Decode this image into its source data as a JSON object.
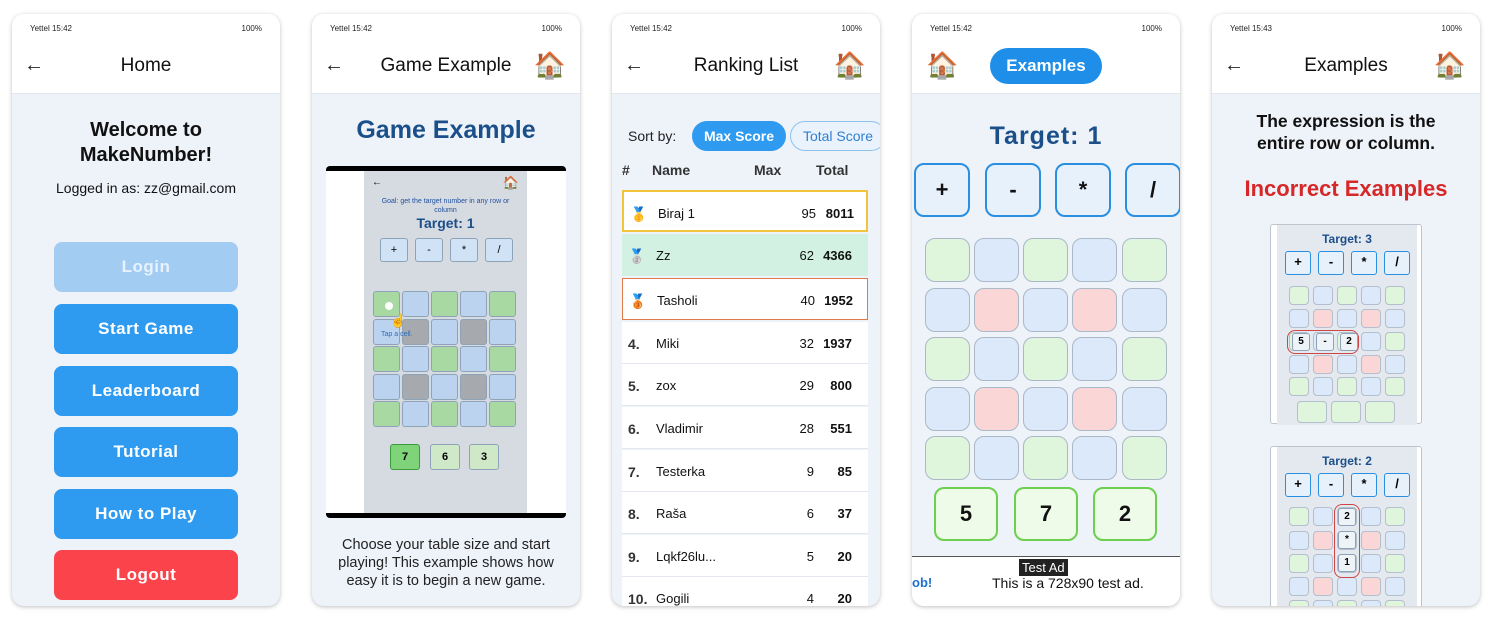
{
  "status": [
    {
      "carrier": "Yettel 15:42",
      "right": "100%"
    },
    {
      "carrier": "Yettel 15:42",
      "right": "100%"
    },
    {
      "carrier": "Yettel 15:42",
      "right": "100%"
    },
    {
      "carrier": "Yettel 15:42",
      "right": "100%"
    },
    {
      "carrier": "Yettel 15:43",
      "right": "100%"
    }
  ],
  "home": {
    "title": "Home",
    "welcome": "Welcome to MakeNumber!",
    "logged": "Logged in as: zz@gmail.com",
    "login": "Login",
    "start": "Start Game",
    "leaderboard": "Leaderboard",
    "tutorial": "Tutorial",
    "howto": "How to Play",
    "logout": "Logout"
  },
  "example": {
    "title": "Game Example",
    "heading": "Game Example",
    "goal": "Goal: get the target number in any row or column",
    "target": "Target: 1",
    "ops": [
      "+",
      "-",
      "*",
      "/"
    ],
    "tap": "Tap a cell.",
    "nums": [
      "7",
      "6",
      "3"
    ],
    "desc": "Choose your table size and start playing! This example shows how easy it is to begin a new game."
  },
  "ranking": {
    "title": "Ranking List",
    "sortby": "Sort by:",
    "max_btn": "Max Score",
    "total_btn": "Total Score",
    "headers": {
      "rank": "#",
      "name": "Name",
      "max": "Max",
      "total": "Total"
    },
    "rows": [
      {
        "rank": "🥇",
        "name": "Biraj 1",
        "max": "95",
        "total": "8011"
      },
      {
        "rank": "🥈",
        "name": "Zz",
        "max": "62",
        "total": "4366"
      },
      {
        "rank": "🥉",
        "name": "Tasholi",
        "max": "40",
        "total": "1952"
      },
      {
        "rank": "4.",
        "name": "Miki",
        "max": "32",
        "total": "1937"
      },
      {
        "rank": "5.",
        "name": "zox",
        "max": "29",
        "total": "800"
      },
      {
        "rank": "6.",
        "name": "Vladimir",
        "max": "28",
        "total": "551"
      },
      {
        "rank": "7.",
        "name": "Testerka",
        "max": "9",
        "total": "85"
      },
      {
        "rank": "8.",
        "name": "Raša",
        "max": "6",
        "total": "37"
      },
      {
        "rank": "9.",
        "name": "Lqkf26lu...",
        "max": "5",
        "total": "20"
      },
      {
        "rank": "10.",
        "name": "Gogili",
        "max": "4",
        "total": "20"
      }
    ]
  },
  "game": {
    "pill": "Examples",
    "target": "Target: 1",
    "ops": [
      "+",
      "-",
      "*",
      "/"
    ],
    "nums": [
      "5",
      "7",
      "2"
    ],
    "ad_label": "Test Ad",
    "ad_text": "This is a 728x90 test ad.",
    "ad_left": "ob!"
  },
  "examples": {
    "title": "Examples",
    "desc": "The expression is the entire row or column.",
    "incorrect": "Incorrect Examples",
    "card1": {
      "target": "Target: 3",
      "ops": [
        "+",
        "-",
        "*",
        "/"
      ],
      "expr": [
        "5",
        "-",
        "2"
      ]
    },
    "card2": {
      "target": "Target: 2",
      "ops": [
        "+",
        "-",
        "*",
        "/"
      ],
      "expr": [
        "2",
        "*",
        "1"
      ]
    }
  },
  "colors": {
    "primary": "#2e9af0",
    "logout": "#fb434b",
    "heading": "#1a4f8a",
    "incorrect": "#d62828"
  }
}
